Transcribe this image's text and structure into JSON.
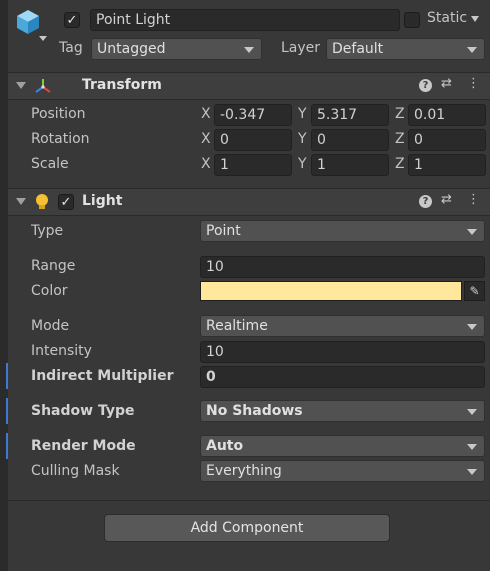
{
  "gameobject": {
    "name": "Point Light",
    "active": true,
    "static_label": "Static",
    "tag_label": "Tag",
    "tag_value": "Untagged",
    "layer_label": "Layer",
    "layer_value": "Default"
  },
  "transform": {
    "title": "Transform",
    "rows": [
      {
        "label": "Position",
        "x": "-0.347",
        "y": "5.317",
        "z": "0.01"
      },
      {
        "label": "Rotation",
        "x": "0",
        "y": "0",
        "z": "0"
      },
      {
        "label": "Scale",
        "x": "1",
        "y": "1",
        "z": "1"
      }
    ],
    "axis": {
      "x": "X",
      "y": "Y",
      "z": "Z"
    }
  },
  "light": {
    "title": "Light",
    "enabled": true,
    "type_label": "Type",
    "type_value": "Point",
    "range_label": "Range",
    "range_value": "10",
    "color_label": "Color",
    "color_value": "#ffe79c",
    "mode_label": "Mode",
    "mode_value": "Realtime",
    "intensity_label": "Intensity",
    "intensity_value": "10",
    "indirect_label": "Indirect Multiplier",
    "indirect_value": "0",
    "shadow_label": "Shadow Type",
    "shadow_value": "No Shadows",
    "render_label": "Render Mode",
    "render_value": "Auto",
    "culling_label": "Culling Mask",
    "culling_value": "Everything"
  },
  "add_component_label": "Add Component",
  "icons": {
    "gameobject": "cube-icon",
    "transform": "transform-axes-icon",
    "light": "lightbulb-icon",
    "help": "help-icon",
    "presets": "presets-icon",
    "menu": "kebab-menu-icon",
    "eyedropper": "eyedropper-icon"
  },
  "colors": {
    "background": "#383838",
    "field": "#2a2a2a",
    "accent": "#3d7ad6",
    "light_icon": "#f5c032"
  }
}
